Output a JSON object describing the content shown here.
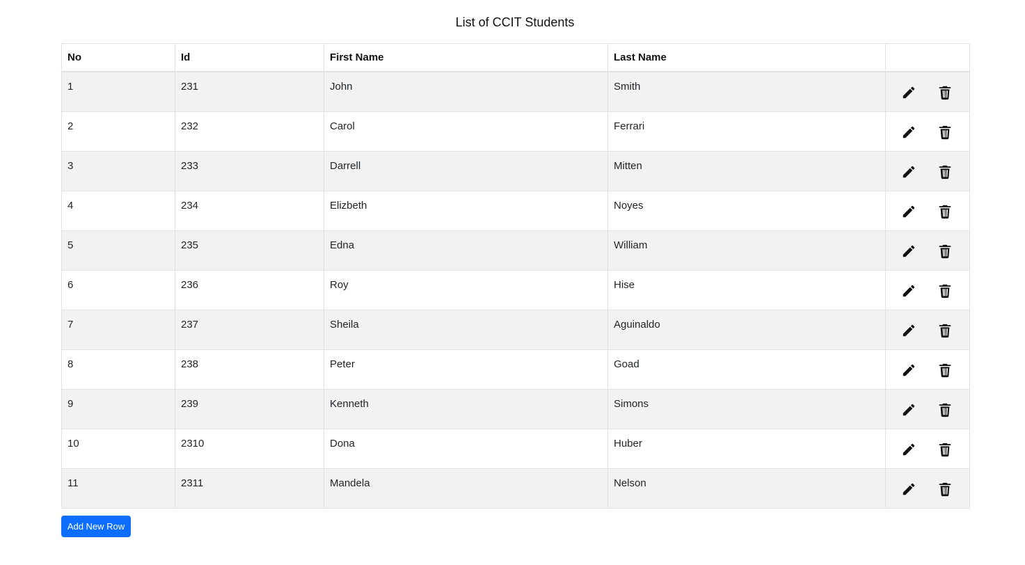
{
  "page": {
    "title": "List of CCIT Students"
  },
  "table": {
    "headers": [
      "No",
      "Id",
      "First Name",
      "Last Name",
      ""
    ],
    "rows": [
      {
        "no": "1",
        "id": "231",
        "first": "John",
        "last": "Smith"
      },
      {
        "no": "2",
        "id": "232",
        "first": "Carol",
        "last": "Ferrari"
      },
      {
        "no": "3",
        "id": "233",
        "first": "Darrell",
        "last": "Mitten"
      },
      {
        "no": "4",
        "id": "234",
        "first": "Elizbeth",
        "last": "Noyes"
      },
      {
        "no": "5",
        "id": "235",
        "first": "Edna",
        "last": "William"
      },
      {
        "no": "6",
        "id": "236",
        "first": "Roy",
        "last": "Hise"
      },
      {
        "no": "7",
        "id": "237",
        "first": "Sheila",
        "last": "Aguinaldo"
      },
      {
        "no": "8",
        "id": "238",
        "first": "Peter",
        "last": "Goad"
      },
      {
        "no": "9",
        "id": "239",
        "first": "Kenneth",
        "last": "Simons"
      },
      {
        "no": "10",
        "id": "2310",
        "first": "Dona",
        "last": "Huber"
      },
      {
        "no": "11",
        "id": "2311",
        "first": "Mandela",
        "last": "Nelson"
      }
    ],
    "row_icons": {
      "edit": "pencil-icon",
      "delete": "trash-icon"
    }
  },
  "actions": {
    "add_label": "Add New Row"
  },
  "colors": {
    "accent": "#0d6efd",
    "stripe": "#f2f2f2",
    "border": "#dee2e6"
  }
}
